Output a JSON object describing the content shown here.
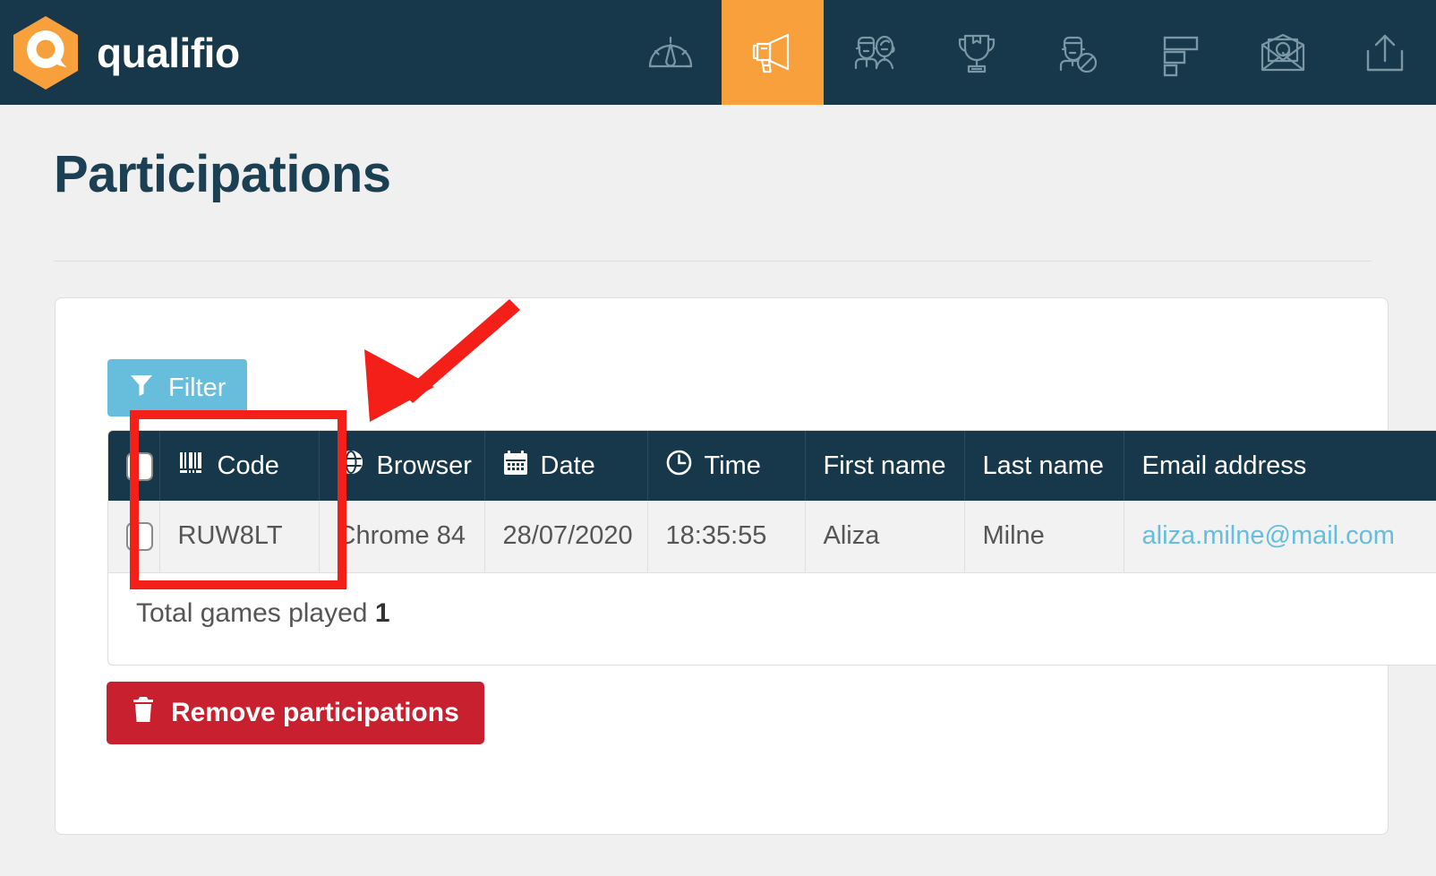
{
  "brand": {
    "name": "qualifio",
    "logo_icon": "qualifio-hexagon-logo",
    "logo_color": "#f7a03c"
  },
  "topnav": {
    "background": "#17384a",
    "active_color": "#f7a03c",
    "items": [
      {
        "icon": "dashboard-gauge-icon",
        "label": "Dashboard",
        "active": false
      },
      {
        "icon": "megaphone-icon",
        "label": "Campaigns",
        "active": true
      },
      {
        "icon": "people-icon",
        "label": "Audience",
        "active": false
      },
      {
        "icon": "trophy-icon",
        "label": "Winners",
        "active": false
      },
      {
        "icon": "blocked-user-icon",
        "label": "Blacklist",
        "active": false
      },
      {
        "icon": "funnel-bars-icon",
        "label": "Reports",
        "active": false
      },
      {
        "icon": "email-at-icon",
        "label": "Emailing",
        "active": false
      },
      {
        "icon": "upload-icon",
        "label": "Export",
        "active": false
      }
    ]
  },
  "page": {
    "title": "Participations",
    "accent_blue": "#66bedc",
    "danger_red": "#c8202f"
  },
  "toolbar": {
    "filter_label": "Filter",
    "filter_icon": "funnel-icon"
  },
  "table": {
    "columns": [
      {
        "key": "check",
        "label": "",
        "icon": "checkbox-icon"
      },
      {
        "key": "code",
        "label": "Code",
        "icon": "barcode-icon"
      },
      {
        "key": "browser",
        "label": "Browser",
        "icon": "globe-browser-icon"
      },
      {
        "key": "date",
        "label": "Date",
        "icon": "calendar-icon"
      },
      {
        "key": "time",
        "label": "Time",
        "icon": "clock-icon"
      },
      {
        "key": "first_name",
        "label": "First name",
        "icon": ""
      },
      {
        "key": "last_name",
        "label": "Last name",
        "icon": ""
      },
      {
        "key": "email",
        "label": "Email address",
        "icon": ""
      }
    ],
    "rows": [
      {
        "code": "RUW8LT",
        "browser": "Chrome 84",
        "date": "28/07/2020",
        "time": "18:35:55",
        "first_name": "Aliza",
        "last_name": "Milne",
        "email": "aliza.milne@mail.com"
      }
    ],
    "footer_label": "Total games played",
    "footer_value": "1"
  },
  "actions": {
    "remove_label": "Remove participations",
    "remove_icon": "trash-icon"
  },
  "annotations": {
    "highlight_color": "#f41f18",
    "box_target": "code-column",
    "arrow_target": "code-column"
  }
}
